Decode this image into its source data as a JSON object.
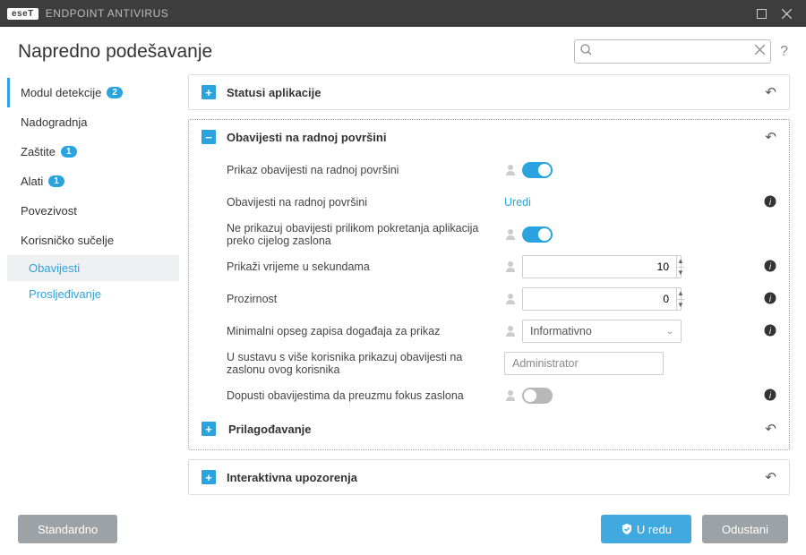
{
  "titlebar": {
    "brand": "eseT",
    "title": "ENDPOINT ANTIVIRUS"
  },
  "header": {
    "page_title": "Napredno podešavanje",
    "search_placeholder": ""
  },
  "sidebar": [
    {
      "label": "Modul detekcije",
      "badge": "2"
    },
    {
      "label": "Nadogradnja",
      "badge": null
    },
    {
      "label": "Zaštite",
      "badge": "1"
    },
    {
      "label": "Alati",
      "badge": "1"
    },
    {
      "label": "Povezivost",
      "badge": null
    },
    {
      "label": "Korisničko sučelje",
      "badge": null
    }
  ],
  "sidebar_subs": [
    {
      "label": "Obavijesti"
    },
    {
      "label": "Prosljeđivanje"
    }
  ],
  "sections": {
    "app_status": {
      "title": "Statusi aplikacije"
    },
    "desktop_notifs": {
      "title": "Obavijesti na radnoj površini",
      "rows": {
        "show": {
          "label": "Prikaz obavijesti na radnoj površini",
          "value": true
        },
        "edit": {
          "label": "Obavijesti na radnoj površini",
          "link": "Uredi"
        },
        "fullscreen": {
          "label": "Ne prikazuj obavijesti prilikom pokretanja aplikacija preko cijelog zaslona",
          "value": true
        },
        "seconds": {
          "label": "Prikaži vrijeme u sekundama",
          "value": "10"
        },
        "transparency": {
          "label": "Prozirnost",
          "value": "0"
        },
        "verbosity": {
          "label": "Minimalni opseg zapisa događaja za prikaz",
          "value": "Informativno"
        },
        "multiuser": {
          "label": "U sustavu s više korisnika prikazuj obavijesti na zaslonu ovog korisnika",
          "value": "Administrator"
        },
        "focus": {
          "label": "Dopusti obavijestima da preuzmu fokus zaslona",
          "value": false
        }
      },
      "custom": {
        "title": "Prilagođavanje"
      }
    },
    "interactive": {
      "title": "Interaktivna upozorenja"
    }
  },
  "footer": {
    "default": "Standardno",
    "ok": "U redu",
    "cancel": "Odustani"
  }
}
